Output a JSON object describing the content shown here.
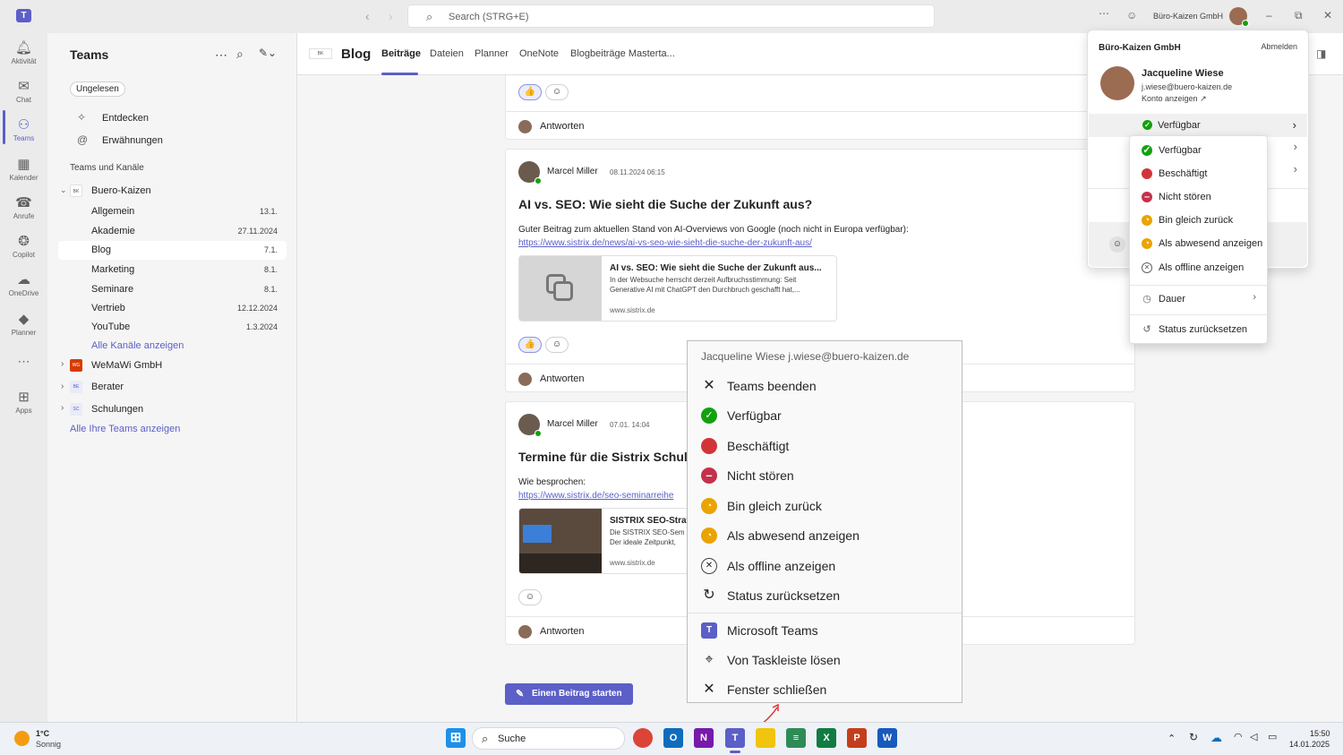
{
  "titlebar": {
    "search_placeholder": "Search (STRG+E)",
    "org_name": "Büro-Kaizen GmbH"
  },
  "rail": {
    "items": [
      {
        "label": "Aktivität",
        "icon": "bell-icon"
      },
      {
        "label": "Chat",
        "icon": "chat-icon"
      },
      {
        "label": "Teams",
        "icon": "teams-icon"
      },
      {
        "label": "Kalender",
        "icon": "calendar-icon"
      },
      {
        "label": "Anrufe",
        "icon": "phone-icon"
      },
      {
        "label": "Copilot",
        "icon": "copilot-icon"
      },
      {
        "label": "OneDrive",
        "icon": "cloud-icon"
      },
      {
        "label": "Planner",
        "icon": "planner-icon"
      },
      {
        "label": "Apps",
        "icon": "apps-icon"
      }
    ]
  },
  "leftpanel": {
    "title": "Teams",
    "filter_chip": "Ungelesen",
    "discover": "Entdecken",
    "mentions": "Erwähnungen",
    "section_label": "Teams und Kanäle",
    "team_name": "Buero-Kaizen",
    "channels": [
      {
        "name": "Allgemein",
        "date": "13.1."
      },
      {
        "name": "Akademie",
        "date": "27.11.2024"
      },
      {
        "name": "Blog",
        "date": "7.1."
      },
      {
        "name": "Marketing",
        "date": "8.1."
      },
      {
        "name": "Seminare",
        "date": "8.1."
      },
      {
        "name": "Vertrieb",
        "date": "12.12.2024"
      },
      {
        "name": "YouTube",
        "date": "1.3.2024"
      }
    ],
    "show_all_channels": "Alle Kanäle anzeigen",
    "other_teams": [
      {
        "name": "WeMaWi GmbH",
        "abbr": "WG"
      },
      {
        "name": "Berater",
        "abbr": "BE"
      },
      {
        "name": "Schulungen",
        "abbr": "SC"
      }
    ],
    "show_all_teams": "Alle Ihre Teams anzeigen"
  },
  "channel": {
    "name": "Blog",
    "tabs": [
      "Beiträge",
      "Dateien",
      "Planner",
      "OneNote",
      "Blogbeiträge Masterta..."
    ]
  },
  "posts": [
    {
      "reply": "Antworten"
    },
    {
      "author": "Marcel Miller",
      "time": "08.11.2024 06:15",
      "title": "AI vs. SEO: Wie sieht die Suche der Zukunft aus?",
      "text": "Guter Beitrag zum aktuellen Stand von AI-Overviews von Google (noch nicht in Europa verfügbar):",
      "link": "https://www.sistrix.de/news/ai-vs-seo-wie-sieht-die-suche-der-zukunft-aus/",
      "preview": {
        "title": "AI vs. SEO: Wie sieht die Suche der Zukunft aus...",
        "desc1": "In der Websuche herrscht derzeit Aufbruchsstimmung: Seit",
        "desc2": "Generative AI mit ChatGPT den Durchbruch geschafft hat,...",
        "domain": "www.sistrix.de"
      },
      "reply": "Antworten"
    },
    {
      "author": "Marcel Miller",
      "time": "07.01. 14:04",
      "title": "Termine für die Sistrix Schulun",
      "text": "Wie besprochen:",
      "link": "https://www.sistrix.de/seo-seminarreihe",
      "preview": {
        "title": "SISTRIX SEO-Strat",
        "desc1": "Die SISTRIX SEO-Sem",
        "desc2": "Der ideale Zeitpunkt,",
        "domain": "www.sistrix.de"
      },
      "reply": "Antworten"
    }
  ],
  "start_post_button": "Einen Beitrag starten",
  "jumplist": {
    "header": "Jacqueline Wiese j.wiese@buero-kaizen.de",
    "items": [
      {
        "label": "Teams beenden",
        "icon": "close-icon"
      },
      {
        "label": "Verfügbar",
        "icon": "status-available-icon"
      },
      {
        "label": "Beschäftigt",
        "icon": "status-busy-icon"
      },
      {
        "label": "Nicht stören",
        "icon": "status-dnd-icon"
      },
      {
        "label": "Bin gleich zurück",
        "icon": "status-away-icon"
      },
      {
        "label": "Als abwesend anzeigen",
        "icon": "status-away-icon"
      },
      {
        "label": "Als offline anzeigen",
        "icon": "status-offline-icon"
      },
      {
        "label": "Status zurücksetzen",
        "icon": "reset-icon"
      },
      {
        "label": "Microsoft Teams",
        "icon": "teams-app-icon"
      },
      {
        "label": "Von Taskleiste lösen",
        "icon": "unpin-icon"
      },
      {
        "label": "Fenster schließen",
        "icon": "close-icon"
      }
    ]
  },
  "profile": {
    "org": "Büro-Kaizen GmbH",
    "signout": "Abmelden",
    "name": "Jacqueline Wiese",
    "email": "j.wiese@buero-kaizen.de",
    "view_account": "Konto anzeigen",
    "status": "Verfügbar"
  },
  "status_menu": {
    "items": [
      "Verfügbar",
      "Beschäftigt",
      "Nicht stören",
      "Bin gleich zurück",
      "Als abwesend anzeigen",
      "Als offline anzeigen"
    ],
    "duration": "Dauer",
    "reset": "Status zurücksetzen"
  },
  "taskbar": {
    "weather_temp": "1°C",
    "weather_desc": "Sonnig",
    "search": "Suche",
    "time": "15:50",
    "date": "14.01.2025"
  },
  "colors": {
    "accent": "#5b5fc7",
    "available": "#13a10e",
    "busy": "#d13438",
    "dnd": "#c4314b",
    "away": "#eaa300"
  }
}
